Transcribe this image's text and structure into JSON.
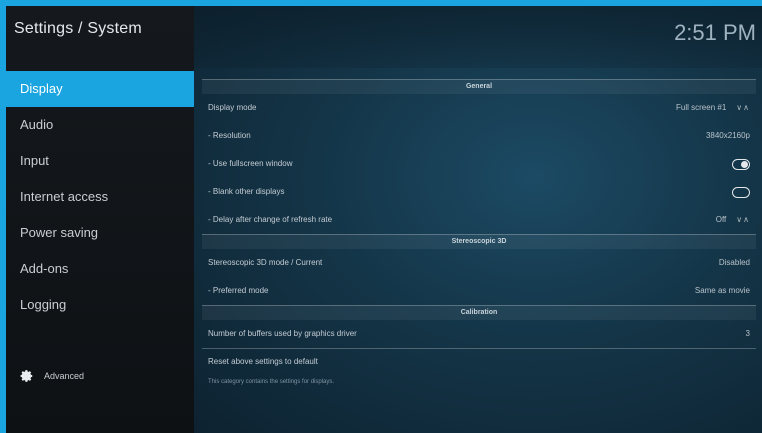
{
  "app": {
    "title": "Settings / System",
    "time": "2:51 PM"
  },
  "sidebar": {
    "items": [
      {
        "label": "Display",
        "active": true
      },
      {
        "label": "Audio"
      },
      {
        "label": "Input"
      },
      {
        "label": "Internet access"
      },
      {
        "label": "Power saving"
      },
      {
        "label": "Add-ons"
      },
      {
        "label": "Logging"
      }
    ],
    "advanced_label": "Advanced"
  },
  "sections": {
    "general": "General",
    "stereo": "Stereoscopic 3D",
    "calibration": "Calibration"
  },
  "settings": {
    "display_mode": {
      "label": "Display mode",
      "value": "Full screen #1"
    },
    "resolution": {
      "label": "- Resolution",
      "value": "3840x2160p"
    },
    "fullscreen_window": {
      "label": "- Use fullscreen window",
      "enabled": true
    },
    "blank_displays": {
      "label": "- Blank other displays",
      "enabled": false
    },
    "refresh_delay": {
      "label": "- Delay after change of refresh rate",
      "value": "Off"
    },
    "stereo_mode": {
      "label": "Stereoscopic 3D mode / Current",
      "value": "Disabled"
    },
    "preferred_mode": {
      "label": "- Preferred mode",
      "value": "Same as movie"
    },
    "buffers": {
      "label": "Number of buffers used by graphics driver",
      "value": "3"
    },
    "reset": {
      "label": "Reset above settings to default"
    }
  },
  "help_text": "This category contains the settings for displays.",
  "colors": {
    "accent": "#1aa4e0",
    "sidebar_bg": "#101316",
    "main_bg": "#143548"
  }
}
